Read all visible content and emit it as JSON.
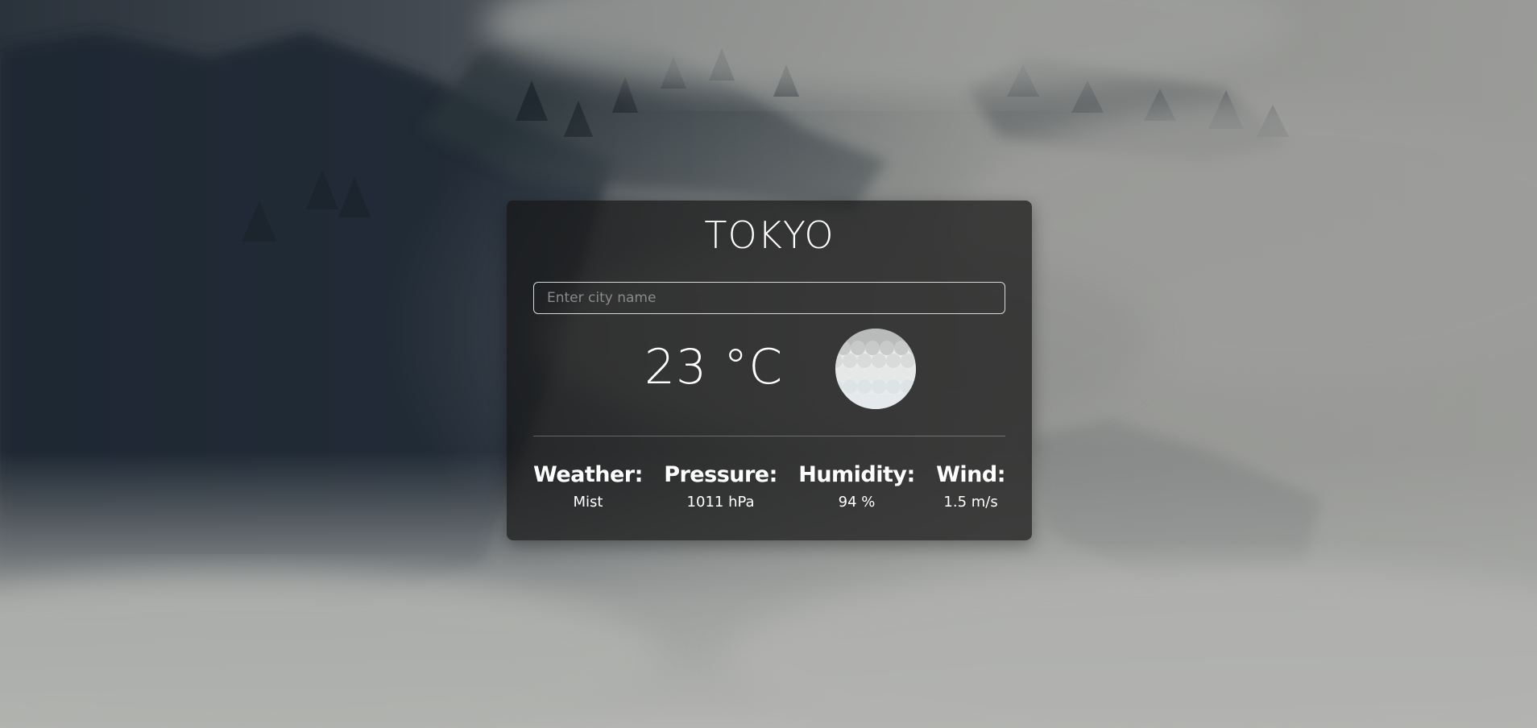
{
  "city": {
    "name": "TOKYO"
  },
  "search": {
    "placeholder": "Enter city name",
    "value": ""
  },
  "current": {
    "temperature": "23 °C",
    "icon": "mist-icon"
  },
  "stats": [
    {
      "label": "Weather:",
      "value": "Mist"
    },
    {
      "label": "Pressure:",
      "value": "1011 hPa"
    },
    {
      "label": "Humidity:",
      "value": "94 %"
    },
    {
      "label": "Wind:",
      "value": "1.5 m/s"
    }
  ],
  "colors": {
    "card_background": "#161616",
    "text": "#ffffff",
    "input_border": "#d8d8d8",
    "placeholder": "#8a8a8a"
  }
}
